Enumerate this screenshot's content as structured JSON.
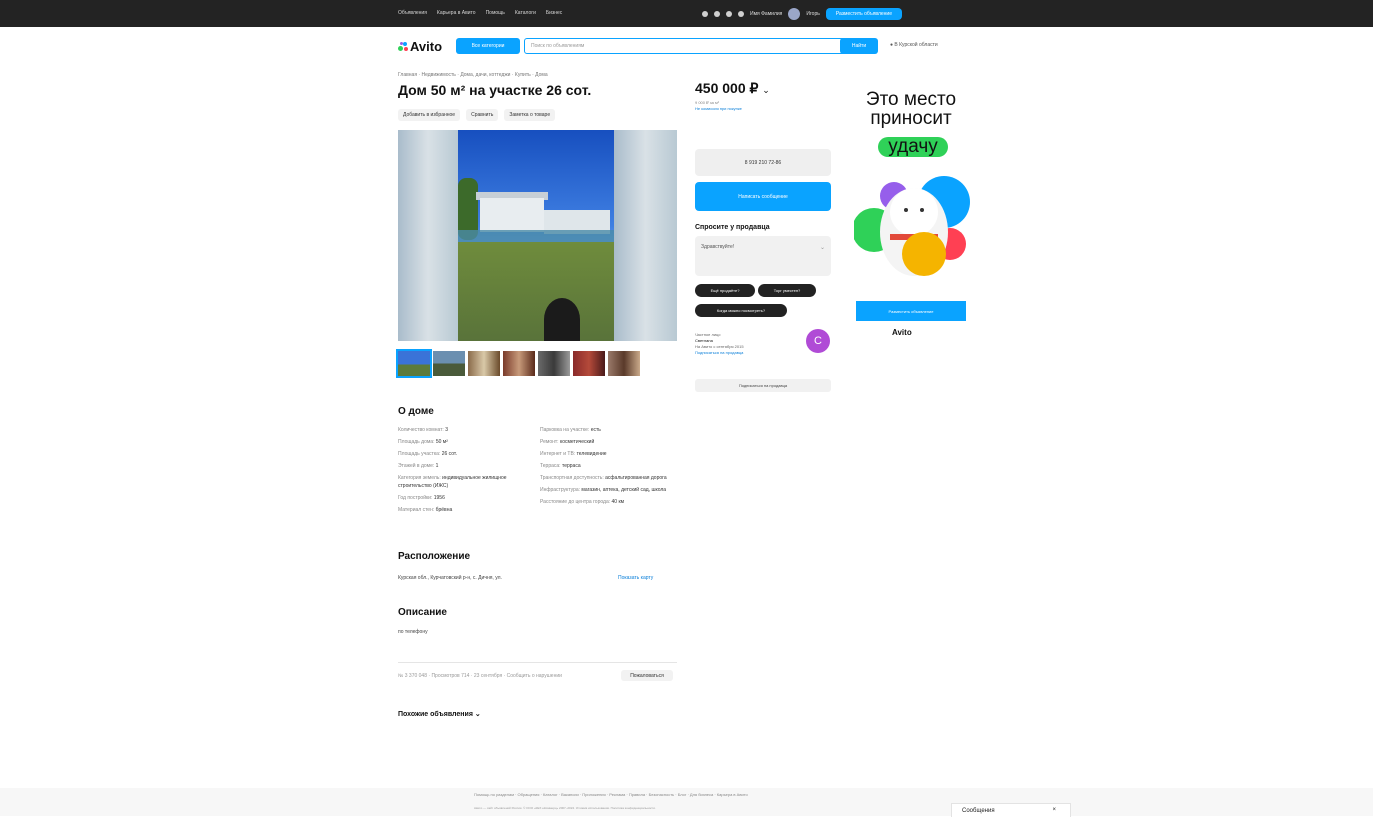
{
  "topbar": {
    "nav": [
      "Объявления",
      "Карьера в Авито",
      "Помощь",
      "Каталоги",
      "Бизнес"
    ],
    "user_name": "Имя Фамилия",
    "user_short": "Игорь",
    "post_button": "Разместить объявление"
  },
  "header": {
    "logo": "Avito",
    "categories_button": "Все категории",
    "search_placeholder": "Поиск по объявлениям",
    "find_button": "Найти",
    "region": "В Курской области"
  },
  "listing": {
    "breadcrumbs": "Главная · Недвижимость · Дома, дачи, коттеджи · Купить · Дома",
    "title": "Дом 50 м² на участке 26 сот.",
    "actions": [
      "Добавить в избранное",
      "Сравнить",
      "Заметка о товаре"
    ],
    "price": "450 000 ₽",
    "price_note_1": "9 000 ₽ за м²",
    "price_note_2": "Не комиссия при покупке",
    "phone": "8 919 210 72-86",
    "message_button": "Написать сообщение",
    "ask_title": "Спросите у продавца",
    "ask_placeholder": "Здравствуйте!",
    "chips": [
      "Ещё продаёте?",
      "Торг уместен?",
      "Когда можно посмотреть?"
    ],
    "seller_type": "Частное лицо",
    "seller_name": "Светлана",
    "seller_since": "На Авито с сентября 2015",
    "seller_link": "Подписаться на продавца",
    "seller_initial": "С",
    "subscribe_button": "Подписаться на продавца"
  },
  "about": {
    "heading": "О доме",
    "left": [
      {
        "k": "Количество комнат:",
        "v": "3"
      },
      {
        "k": "Площадь дома:",
        "v": "50 м²"
      },
      {
        "k": "Площадь участка:",
        "v": "26 сот."
      },
      {
        "k": "Этажей в доме:",
        "v": "1"
      },
      {
        "k": "Категория земель:",
        "v": "индивидуальное жилищное строительство (ИЖС)"
      },
      {
        "k": "Год постройки:",
        "v": "1956"
      },
      {
        "k": "Материал стен:",
        "v": "брёвна"
      }
    ],
    "right": [
      {
        "k": "Парковка на участке:",
        "v": "есть"
      },
      {
        "k": "Ремонт:",
        "v": "косметический"
      },
      {
        "k": "Интернет и ТВ:",
        "v": "телевидение"
      },
      {
        "k": "Терраса:",
        "v": "терраса"
      },
      {
        "k": "Транспортная доступность:",
        "v": "асфальтированная дорога"
      },
      {
        "k": "Инфраструктура:",
        "v": "магазин, аптека, детский сад, школа"
      },
      {
        "k": "Расстояние до центра города:",
        "v": "40 км"
      }
    ]
  },
  "location": {
    "heading": "Расположение",
    "address": "Курская обл., Курчатовский р-н, с. Дичня, ул.",
    "map_link": "Показать карту"
  },
  "description": {
    "heading": "Описание",
    "text": "по телефону"
  },
  "meta": {
    "info": "№ 3 370 048 · Просмотров 714 · 23 сентября · Сообщить о нарушении",
    "complain_button": "Пожаловаться"
  },
  "similar": "Похожие объявления",
  "ad": {
    "line1": "Это место",
    "line2": "приносит",
    "line3": "удачу",
    "button": "Разместить объявление",
    "logo": "Avito"
  },
  "footer": {
    "links": "Помощь по разделам · Обращения · Каталог · Вакансии · Приложения · Реклама · Правила · Безопасность · Блог · Для бизнеса · Карьера в Авито",
    "legal": "Авито — сайт объявлений России. © ООО «КЕХ еКоммерц» 2007–2024. Условия использования. Политика конфиденциальности."
  },
  "messenger": {
    "label": "Сообщения",
    "close": "×"
  },
  "colors": {
    "accent": "#0aa3ff",
    "topbar": "#232323",
    "luck_green": "#2fd158",
    "seller_avatar": "#b04bd6"
  }
}
